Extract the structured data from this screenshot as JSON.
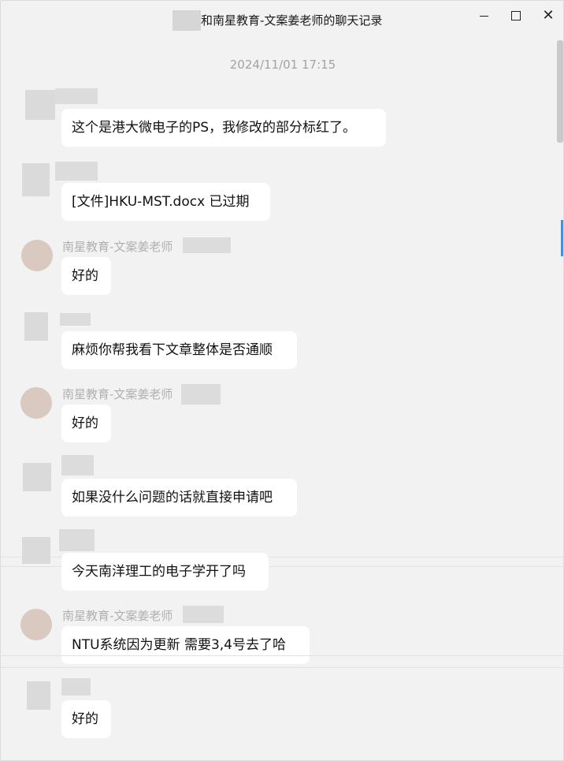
{
  "window": {
    "title": "和南星教育-文案姜老师的聊天记录",
    "minimize_icon": "minimize-icon",
    "maximize_icon": "maximize-icon",
    "close_icon": "close-icon",
    "close_glyph": "✕"
  },
  "chat": {
    "timestamp": "2024/11/01 17:15",
    "teacher_name": "南星教育-文案姜老师",
    "messages": [
      {
        "text": "这个是港大微电子的PS，我修改的部分标红了。"
      },
      {
        "text": "[文件]HKU-MST.docx 已过期"
      },
      {
        "text": "好的"
      },
      {
        "text": "麻烦你帮我看下文章整体是否通顺"
      },
      {
        "text": "好的"
      },
      {
        "text": "如果没什么问题的话就直接申请吧"
      },
      {
        "text": "今天南洋理工的电子学开了吗"
      },
      {
        "text": "NTU系统因为更新 需要3,4号去了哈"
      },
      {
        "text": "好的"
      }
    ]
  },
  "colors": {
    "window_bg": "#f2f2f2",
    "bubble_bg": "#ffffff",
    "accent": "#4a8fd8"
  }
}
